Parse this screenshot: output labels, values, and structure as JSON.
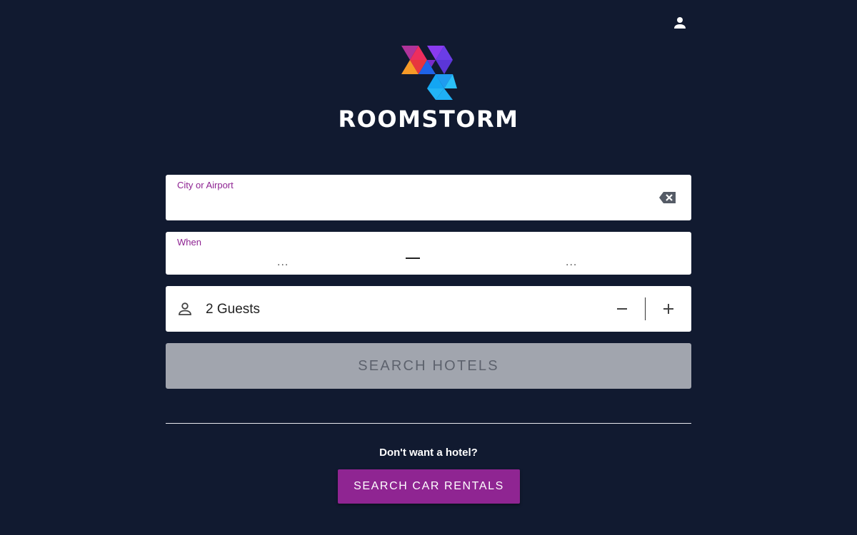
{
  "brand": {
    "name": "ROOMSTORM",
    "logo_icon": "roomstorm-logo"
  },
  "header": {
    "account_icon": "person-icon"
  },
  "search": {
    "city": {
      "label": "City or Airport",
      "value": "",
      "clear_icon": "backspace-clear-icon"
    },
    "when": {
      "label": "When",
      "start_placeholder": "...",
      "end_placeholder": "..."
    },
    "guests": {
      "icon": "person-outline-icon",
      "label": "2 Guests",
      "count": 2,
      "decrement_icon": "minus-icon",
      "increment_icon": "plus-icon"
    },
    "submit_label": "SEARCH HOTELS"
  },
  "alternative": {
    "prompt": "Don't want a hotel?",
    "button_label": "SEARCH CAR RENTALS"
  },
  "colors": {
    "background": "#111a30",
    "accent": "#8f2592",
    "disabled_button": "#a1a5ae"
  }
}
